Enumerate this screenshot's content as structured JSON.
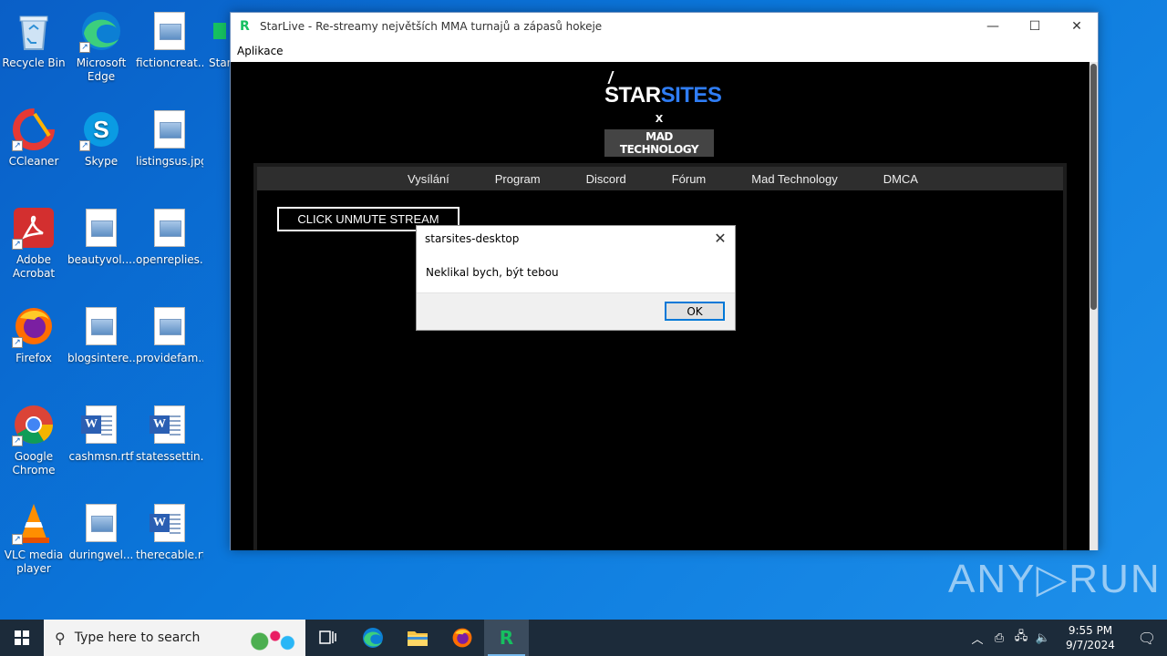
{
  "desktop": {
    "icons": [
      {
        "label": "Recycle Bin"
      },
      {
        "label": "Microsoft Edge"
      },
      {
        "label": "fictioncreat..."
      },
      {
        "label": "Star"
      },
      {
        "label": "CCleaner"
      },
      {
        "label": "Skype"
      },
      {
        "label": "listingsus.jpg"
      },
      {
        "label": "Adobe Acrobat"
      },
      {
        "label": "beautyvol...."
      },
      {
        "label": "openreplies..."
      },
      {
        "label": "Firefox"
      },
      {
        "label": "blogsintere..."
      },
      {
        "label": "providefam..."
      },
      {
        "label": "Google Chrome"
      },
      {
        "label": "cashmsn.rtf"
      },
      {
        "label": "statessettin..."
      },
      {
        "label": "VLC media player"
      },
      {
        "label": "duringwel..."
      },
      {
        "label": "therecable.rtf"
      }
    ]
  },
  "window": {
    "title": "StarLive - Re-streamy největších MMA turnajů a zápasů hokeje",
    "menu": [
      "Aplikace"
    ],
    "controls": {
      "minimize": "—",
      "maximize": "☐",
      "close": "✕"
    }
  },
  "site": {
    "logo": {
      "star": "STAR",
      "sites": "SITES",
      "x": "X",
      "mad": "MAD TECHNOLOGY"
    },
    "nav": [
      "Vysílání",
      "Program",
      "Discord",
      "Fórum",
      "Mad Technology",
      "DMCA"
    ],
    "unmute_label": "CLICK UNMUTE STREAM"
  },
  "dialog": {
    "title": "starsites-desktop",
    "message": "Neklikal bych, být tebou",
    "ok_label": "OK",
    "close_glyph": "✕"
  },
  "watermark": "ANY▷RUN",
  "taskbar": {
    "search_placeholder": "Type here to search",
    "time": "9:55 PM",
    "date": "9/7/2024"
  },
  "colors": {
    "accent_blue": "#2f7df5",
    "app_green": "#16c060",
    "dialog_focus": "#0078d7"
  }
}
